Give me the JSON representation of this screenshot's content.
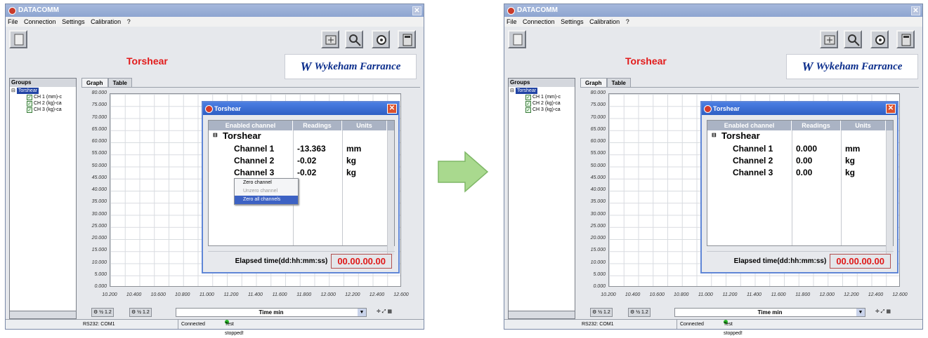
{
  "window_title": "DATACOMM",
  "menu": [
    "File",
    "Connection",
    "Settings",
    "Calibration",
    "?"
  ],
  "app_title": "Torshear",
  "logo_text": "Wykeham Farrance",
  "groups": {
    "header": "Groups",
    "root": "Torshear",
    "channels": [
      "CH 1 (mm)-c",
      "CH 2 (kg)-ca",
      "CH 3 (kg)-ca"
    ]
  },
  "tabs": [
    "Graph",
    "Table"
  ],
  "y_ticks": [
    "80.000",
    "75.000",
    "70.000",
    "65.000",
    "60.000",
    "55.000",
    "50.000",
    "45.000",
    "40.000",
    "35.000",
    "30.000",
    "25.000",
    "20.000",
    "15.000",
    "10.000",
    "5.000",
    "0.000"
  ],
  "x_ticks": [
    "10.200",
    "10.400",
    "10.600",
    "10.800",
    "11.000",
    "11.200",
    "11.400",
    "11.600",
    "11.800",
    "12.000",
    "12.200",
    "12.400",
    "12.600"
  ],
  "axis_selector": "Time min",
  "status": {
    "port": "RS232: COM1",
    "connection": "Connected",
    "test": "Test stopped!"
  },
  "dialog": {
    "title": "Torshear",
    "columns": [
      "Enabled channel",
      "Readings",
      "Units"
    ],
    "group": "Torshear",
    "elapsed_label": "Elapsed time(dd:hh:mm:ss)",
    "elapsed_value": "00.00.00.00"
  },
  "before": {
    "rows": [
      {
        "channel": "Channel 1",
        "reading": "-13.363",
        "unit": "mm"
      },
      {
        "channel": "Channel 2",
        "reading": "-0.02",
        "unit": "kg"
      },
      {
        "channel": "Channel 3",
        "reading": "-0.02",
        "unit": "kg"
      }
    ],
    "context_menu": [
      "Zero channel",
      "Unzero channel",
      "Zero all channels"
    ]
  },
  "after": {
    "rows": [
      {
        "channel": "Channel 1",
        "reading": "0.000",
        "unit": "mm"
      },
      {
        "channel": "Channel 2",
        "reading": "0.00",
        "unit": "kg"
      },
      {
        "channel": "Channel 3",
        "reading": "0.00",
        "unit": "kg"
      }
    ]
  },
  "colors": {
    "title_red": "#e21b1b",
    "logo_blue": "#0a2d8c",
    "dialog_title_blue": "#2e5fc4",
    "arrow_green": "#a9d98e"
  }
}
